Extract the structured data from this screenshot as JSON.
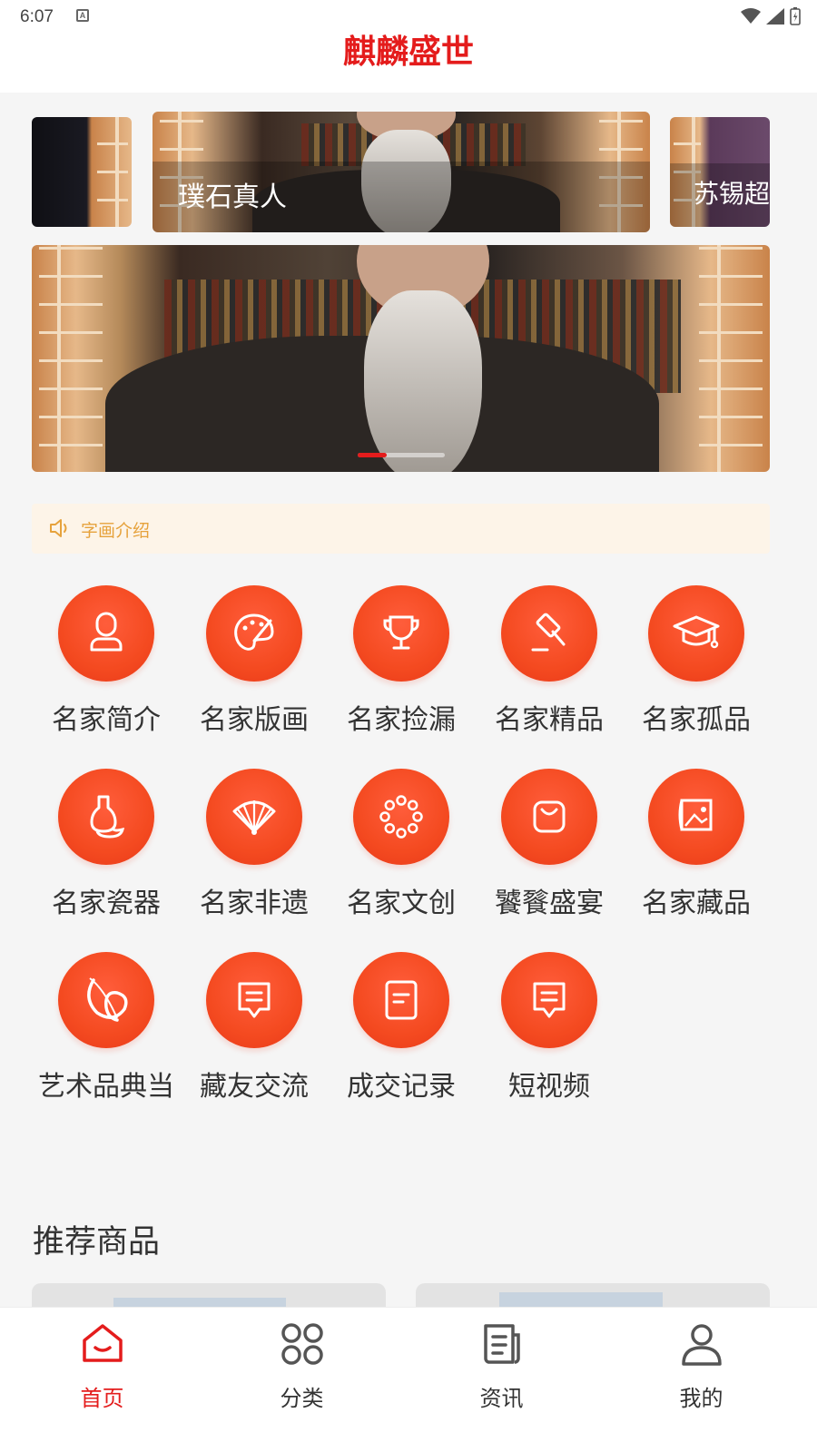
{
  "status_bar": {
    "time": "6:07",
    "notif": "A"
  },
  "header": {
    "title": "麒麟盛世"
  },
  "mini_carousel": {
    "slides": [
      {
        "label": ""
      },
      {
        "label": "璞石真人"
      },
      {
        "label": "苏锡超"
      }
    ]
  },
  "banner": {
    "active_index": 0,
    "slide_count": 3
  },
  "notice": {
    "text": "字画介绍",
    "icon": "speaker-icon"
  },
  "grid": {
    "items": [
      {
        "label": "名家简介",
        "icon": "person-icon"
      },
      {
        "label": "名家版画",
        "icon": "palette-icon"
      },
      {
        "label": "名家捡漏",
        "icon": "trophy-icon"
      },
      {
        "label": "名家精品",
        "icon": "auction-hammer-icon"
      },
      {
        "label": "名家孤品",
        "icon": "graduation-cap-icon"
      },
      {
        "label": "名家瓷器",
        "icon": "vase-icon"
      },
      {
        "label": "名家非遗",
        "icon": "fan-icon"
      },
      {
        "label": "名家文创",
        "icon": "bead-ring-icon"
      },
      {
        "label": "饕餮盛宴",
        "icon": "bag-icon"
      },
      {
        "label": "名家藏品",
        "icon": "scroll-icon"
      },
      {
        "label": "艺术品典当",
        "icon": "brush-stroke-icon"
      },
      {
        "label": "藏友交流",
        "icon": "message-icon"
      },
      {
        "label": "成交记录",
        "icon": "document-icon"
      },
      {
        "label": "短视频",
        "icon": "message-icon"
      }
    ]
  },
  "recommend": {
    "title": "推荐商品"
  },
  "bottom_nav": {
    "active": "home",
    "items": [
      {
        "label": "首页",
        "icon": "home-icon"
      },
      {
        "label": "分类",
        "icon": "category-icon"
      },
      {
        "label": "资讯",
        "icon": "news-icon"
      },
      {
        "label": "我的",
        "icon": "profile-icon"
      }
    ]
  },
  "colors": {
    "accent": "#e41c1c",
    "icon_bg": "#f44a20",
    "notice_text": "#e6a23c",
    "notice_bg": "#fdf4e8"
  }
}
